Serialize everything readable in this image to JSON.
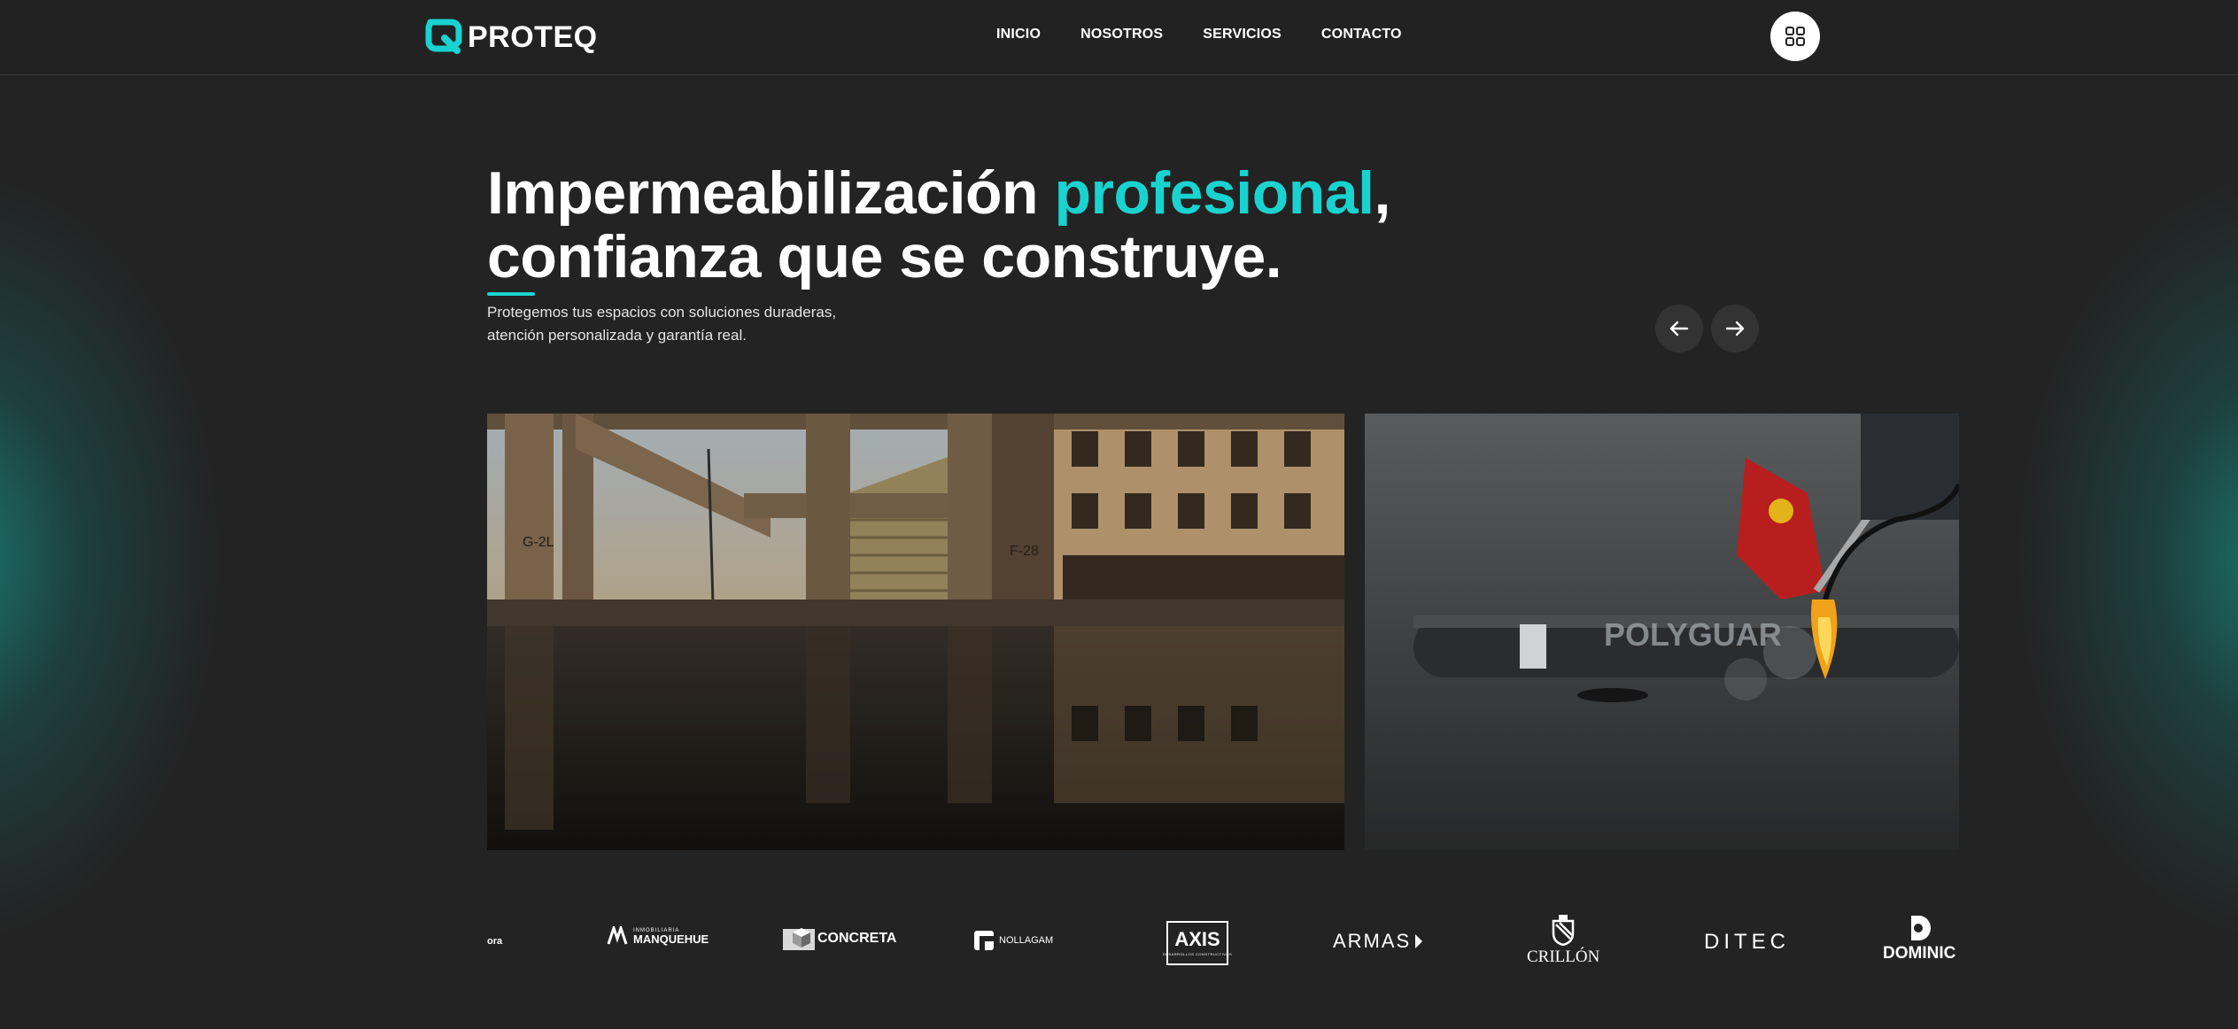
{
  "header": {
    "brand": "PROTEQ",
    "nav": [
      "INICIO",
      "NOSOTROS",
      "SERVICIOS",
      "CONTACTO"
    ],
    "menu_icon": "grid-icon"
  },
  "hero": {
    "title_part1": "Impermeabilización ",
    "title_accent": "profesional",
    "title_part2": ",",
    "title_line2": "confianza que se construye.",
    "subtitle_line1": "Protegemos tus espacios con soluciones duraderas,",
    "subtitle_line2": "atención personalizada y garantía real."
  },
  "carousel": {
    "prev_icon": "arrow-left-icon",
    "next_icon": "arrow-right-icon",
    "slides": [
      {
        "photo_labels": [
          "G-2L",
          "F-28"
        ]
      },
      {
        "photo_labels": [
          "POLYGUAR"
        ]
      }
    ]
  },
  "clients": {
    "partial_first": "ora",
    "manquehue_top": "INMOBILIARIA",
    "manquehue": "MANQUEHUE",
    "concreta": "CONCRETA",
    "nollagam": "NOLLAGAM",
    "axis": "AXIS",
    "axis_sub": "DESARROLLOS CONSTRUCTIVOS",
    "armas": "ARMAS",
    "crillon": "CRILLÓN",
    "ditec": "DITEC",
    "dominic": "DOMINIC"
  },
  "colors": {
    "accent": "#19d3d0",
    "background": "#232323",
    "glow": "#19968c"
  }
}
